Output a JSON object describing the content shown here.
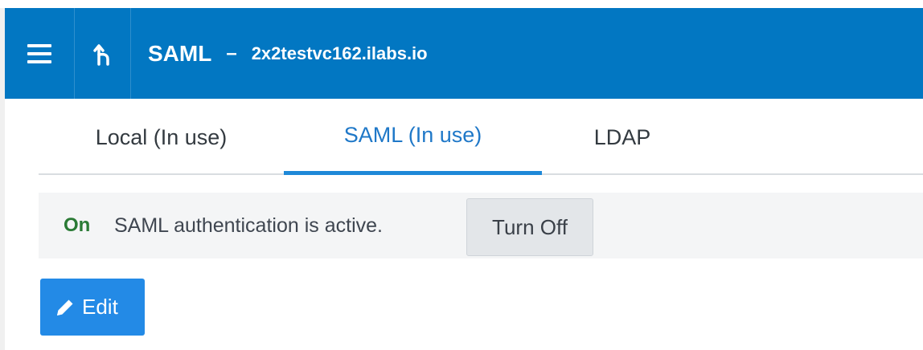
{
  "header": {
    "menu_icon": "hamburger-menu-icon",
    "back_icon": "back-arrow-icon",
    "title": "SAML",
    "separator": "–",
    "subtitle": "2x2testvc162.ilabs.io",
    "background_color": "#0277c2"
  },
  "tabs": [
    {
      "label": "Local (In use)",
      "active": false
    },
    {
      "label": "SAML (In use)",
      "active": true
    },
    {
      "label": "LDAP",
      "active": false
    }
  ],
  "status": {
    "state": "On",
    "message": "SAML authentication is active.",
    "toggle_label": "Turn Off",
    "state_color": "#2a7a35"
  },
  "actions": {
    "edit_label": "Edit",
    "edit_icon": "pencil-icon",
    "edit_color": "#238ae6"
  },
  "colors": {
    "accent": "#1e88d8"
  }
}
